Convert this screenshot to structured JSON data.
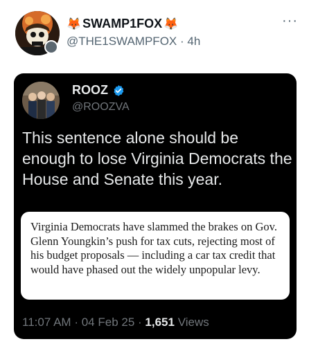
{
  "author": {
    "display_name": "SWAMP1FOX",
    "fox_emoji": "🦊",
    "handle": "@THE1SWAMPFOX",
    "separator": "·",
    "time": "4h",
    "avatar_icon": "pirate-skull-avatar",
    "badge_icon": "affiliate-badge-icon"
  },
  "more_button": {
    "label": "···"
  },
  "embedded_post": {
    "display_name": "ROOZ",
    "handle": "@ROOZVA",
    "verified_icon": "verified-badge-icon",
    "verified_color": "#1d9bf0",
    "text": "This sentence alone should be enough to lose Virginia Democrats the House and Senate this year.",
    "quote": "Virginia Democrats have slammed the brakes on Gov. Glenn Youngkin’s push for tax cuts, rejecting most of his budget proposals — including a car tax credit that would have phased out the widely unpopular levy.",
    "time": "11:07 AM",
    "sep1": "·",
    "date": "04 Feb 25",
    "sep2": "·",
    "views_count": "1,651",
    "views_label": "Views"
  }
}
